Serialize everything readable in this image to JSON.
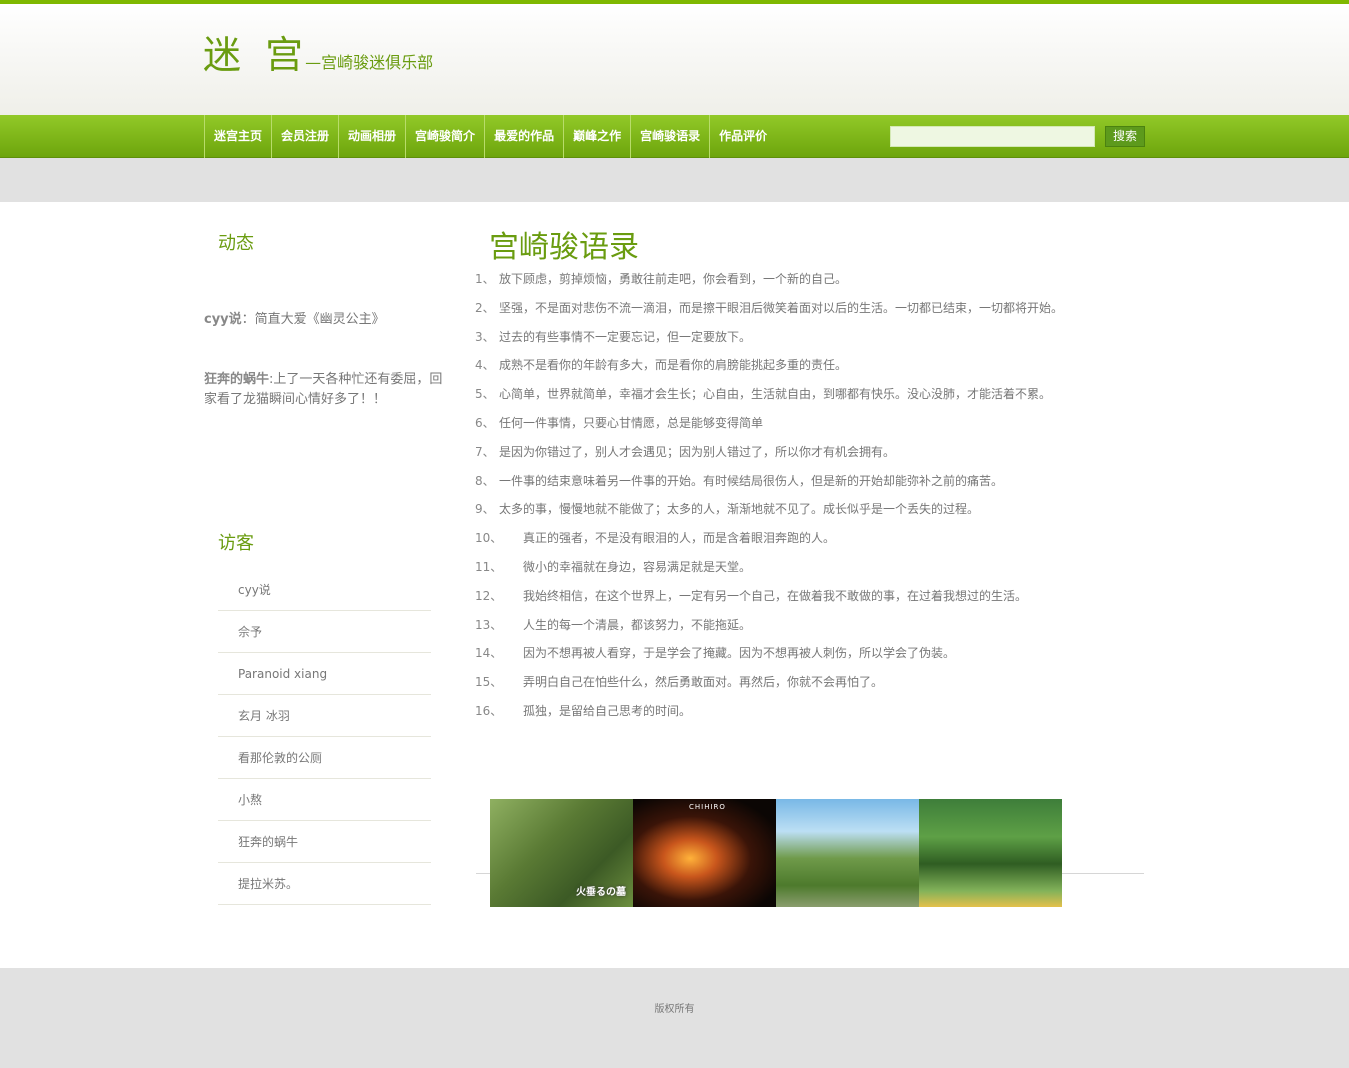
{
  "site": {
    "logo_main": "迷 宫",
    "logo_sub": "—宫崎骏迷俱乐部"
  },
  "nav": {
    "items": [
      "迷宫主页",
      "会员注册",
      "动画相册",
      "宫崎骏简介",
      "最爱的作品",
      "巅峰之作",
      "宫崎骏语录",
      "作品评价"
    ],
    "search_placeholder": "",
    "search_button": "搜索"
  },
  "sidebar": {
    "news_heading": "动态",
    "feed": [
      {
        "user": "cyy说",
        "sep": "：",
        "text": "简直大爱《幽灵公主》"
      },
      {
        "user": "狂奔的蜗牛",
        "sep": ":",
        "text": "上了一天各种忙还有委屈，回家看了龙猫瞬间心情好多了！！"
      }
    ],
    "visitors_heading": "访客",
    "visitors": [
      "cyy说",
      "佘予",
      "Paranoid xiang",
      "玄月 冰羽",
      "看那伦敦的公厕",
      "小熬",
      "狂奔的蜗牛",
      "提拉米苏。"
    ]
  },
  "main": {
    "title": "宫崎骏语录",
    "quotes": [
      {
        "num": "1、",
        "text": "放下顾虑，剪掉烦恼，勇敢往前走吧，你会看到，一个新的自己。"
      },
      {
        "num": "2、",
        "text": "坚强，不是面对悲伤不流一滴泪，而是擦干眼泪后微笑着面对以后的生活。一切都已结束，一切都将开始。"
      },
      {
        "num": "3、",
        "text": "过去的有些事情不一定要忘记，但一定要放下。"
      },
      {
        "num": "4、",
        "text": "成熟不是看你的年龄有多大，而是看你的肩膀能挑起多重的责任。"
      },
      {
        "num": "5、",
        "text": "心简单，世界就简单，幸福才会生长；心自由，生活就自由，到哪都有快乐。没心没肺，才能活着不累。"
      },
      {
        "num": "6、",
        "text": "任何一件事情，只要心甘情愿，总是能够变得简单"
      },
      {
        "num": "7、",
        "text": "是因为你错过了，别人才会遇见；因为别人错过了，所以你才有机会拥有。"
      },
      {
        "num": "8、",
        "text": "一件事的结束意味着另一件事的开始。有时候结局很伤人，但是新的开始却能弥补之前的痛苦。"
      },
      {
        "num": "9、",
        "text": "太多的事，慢慢地就不能做了；太多的人，渐渐地就不见了。成长似乎是一个丢失的过程。"
      },
      {
        "num": "10、",
        "text": "真正的强者，不是没有眼泪的人，而是含着眼泪奔跑的人。"
      },
      {
        "num": "11、",
        "text": "微小的幸福就在身边，容易满足就是天堂。"
      },
      {
        "num": "12、",
        "text": "我始终相信，在这个世界上，一定有另一个自己，在做着我不敢做的事，在过着我想过的生活。"
      },
      {
        "num": "13、",
        "text": "人生的每一个清晨，都该努力，不能拖延。"
      },
      {
        "num": "14、",
        "text": "因为不想再被人看穿，于是学会了掩藏。因为不想再被人刺伤，所以学会了伪装。"
      },
      {
        "num": "15、",
        "text": "弄明白自己在怕些什么，然后勇敢面对。再然后，你就不会再怕了。"
      },
      {
        "num": "16、",
        "text": "孤独，是留给自己思考的时间。"
      }
    ]
  },
  "gallery": {
    "caption_1": "火垂るの墓",
    "title_2": "CHIHIRO"
  },
  "footer": {
    "copyright": "版权所有"
  }
}
